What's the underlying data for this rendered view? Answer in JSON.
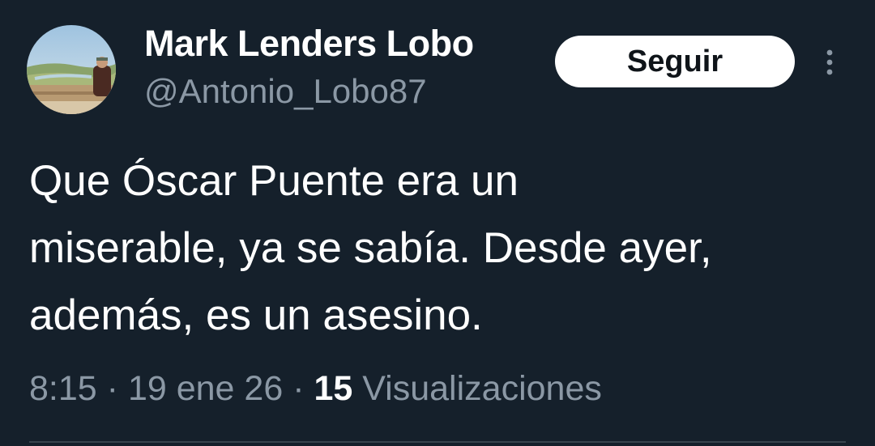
{
  "author": {
    "display_name": "Mark Lenders Lobo",
    "handle": "@Antonio_Lobo87"
  },
  "actions": {
    "follow_label": "Seguir",
    "more_icon": "more-vertical-icon"
  },
  "tweet": {
    "text": "Que Óscar Puente era un\nmiserable, ya se sabía. Desde ayer,\nademás, es un asesino."
  },
  "meta": {
    "time": "8:15",
    "separator": "·",
    "date": "19 ene 26",
    "views_count": "15",
    "views_label": "Visualizaciones"
  },
  "colors": {
    "background": "#15202b",
    "secondary_text": "#8b98a5",
    "button_bg": "#ffffff",
    "button_text": "#0f1419"
  }
}
